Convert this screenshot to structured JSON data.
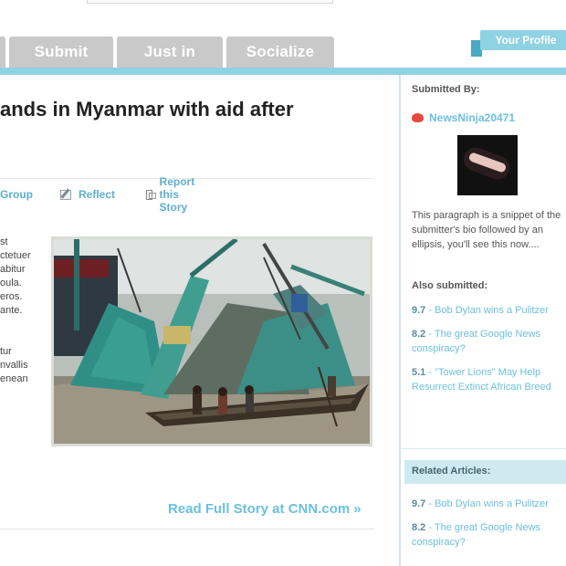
{
  "nav": {
    "tabs": [
      {
        "label": ""
      },
      {
        "label": "Submit"
      },
      {
        "label": "Just in"
      },
      {
        "label": "Socialize"
      }
    ],
    "profile_tab": "Your Profile"
  },
  "article": {
    "headline": "ands in Myanmar with aid after",
    "actions": {
      "group": "Group",
      "reflect": "Reflect",
      "report": "Report this Story"
    },
    "body_lines": [
      "st",
      "ctetuer",
      "abitur",
      "oula.",
      "eros.",
      "ante.",
      "",
      "",
      "tur",
      "nvallis",
      "enean"
    ],
    "read_more": "Read Full Story at CNN.com »"
  },
  "sidebar": {
    "submitted_heading": "Submitted By:",
    "submitter": "NewsNinja20471",
    "bio": "This paragraph is a snippet of the submitter's bio followed by an ellipsis, you'll see this now....",
    "also_heading": "Also submitted:",
    "also_items": [
      {
        "score": "9.7",
        "title": "Bob Dylan wins a Pulitzer"
      },
      {
        "score": "8.2",
        "title": "The great Google News conspiracy?"
      },
      {
        "score": "5.1",
        "title": "\"Tower Lions\" May Help Resurrect Extinct African Breed"
      }
    ],
    "related_heading": "Related Articles:",
    "related_items": [
      {
        "score": "9.7",
        "title": "Bob Dylan wins a Pulitzer"
      },
      {
        "score": "8.2",
        "title": "The great Google News conspiracy?"
      }
    ]
  },
  "colors": {
    "accent": "#8fd2e4",
    "link": "#6cc0de",
    "tab_gray": "#c9c9c9"
  }
}
